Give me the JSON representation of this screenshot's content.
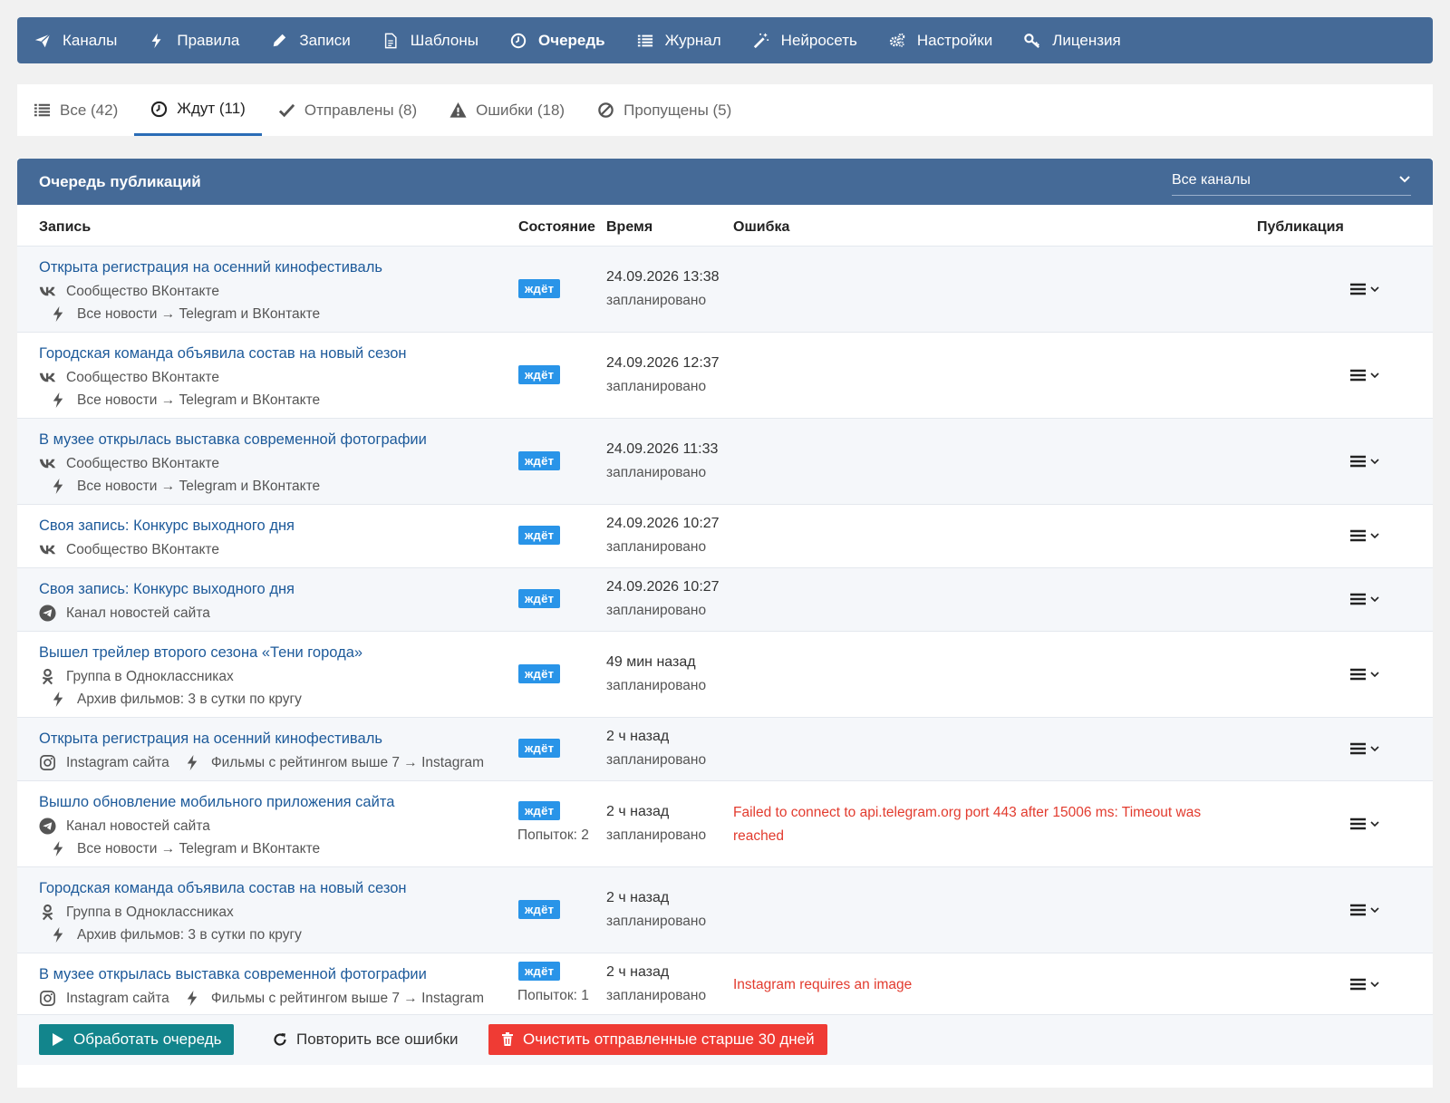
{
  "nav": {
    "items": [
      {
        "label": "Каналы",
        "icon": "paper-plane-icon"
      },
      {
        "label": "Правила",
        "icon": "bolt-icon"
      },
      {
        "label": "Записи",
        "icon": "pencil-icon"
      },
      {
        "label": "Шаблоны",
        "icon": "document-icon"
      },
      {
        "label": "Очередь",
        "icon": "clock-icon"
      },
      {
        "label": "Журнал",
        "icon": "list-icon"
      },
      {
        "label": "Нейросеть",
        "icon": "magic-wand-icon"
      },
      {
        "label": "Настройки",
        "icon": "gears-icon"
      },
      {
        "label": "Лицензия",
        "icon": "key-icon"
      }
    ],
    "active": "Очередь"
  },
  "tabs": [
    {
      "label": "Все (42)",
      "icon": "list-icon"
    },
    {
      "label": "Ждут (11)",
      "icon": "clock-icon"
    },
    {
      "label": "Отправлены (8)",
      "icon": "check-icon"
    },
    {
      "label": "Ошибки (18)",
      "icon": "warning-icon"
    },
    {
      "label": "Пропущены (5)",
      "icon": "ban-icon"
    }
  ],
  "active_tab": "Ждут (11)",
  "panel": {
    "title": "Очередь публикаций",
    "channel_filter": "Все каналы"
  },
  "columns": {
    "record": "Запись",
    "state": "Состояние",
    "time": "Время",
    "error": "Ошибка",
    "publication": "Публикация"
  },
  "rows": [
    {
      "title": "Открыта регистрация на осенний кинофестиваль",
      "channel": "Сообщество ВКонтакте",
      "channel_icon": "vk-icon",
      "rule": "Все новости → Telegram и ВКонтакте",
      "badge": "ждёт",
      "attempts": "",
      "time": "24.09.2026 13:38",
      "status": "запланировано",
      "error": ""
    },
    {
      "title": "Городская команда объявила состав на новый сезон",
      "channel": "Сообщество ВКонтакте",
      "channel_icon": "vk-icon",
      "rule": "Все новости → Telegram и ВКонтакте",
      "badge": "ждёт",
      "attempts": "",
      "time": "24.09.2026 12:37",
      "status": "запланировано",
      "error": ""
    },
    {
      "title": "В музее открылась выставка современной фотографии",
      "channel": "Сообщество ВКонтакте",
      "channel_icon": "vk-icon",
      "rule": "Все новости → Telegram и ВКонтакте",
      "badge": "ждёт",
      "attempts": "",
      "time": "24.09.2026 11:33",
      "status": "запланировано",
      "error": ""
    },
    {
      "title": "Своя запись: Конкурс выходного дня",
      "channel": "Сообщество ВКонтакте",
      "channel_icon": "vk-icon",
      "rule": "",
      "badge": "ждёт",
      "attempts": "",
      "time": "24.09.2026 10:27",
      "status": "запланировано",
      "error": ""
    },
    {
      "title": "Своя запись: Конкурс выходного дня",
      "channel": "Канал новостей сайта",
      "channel_icon": "telegram-icon",
      "rule": "",
      "badge": "ждёт",
      "attempts": "",
      "time": "24.09.2026 10:27",
      "status": "запланировано",
      "error": ""
    },
    {
      "title": "Вышел трейлер второго сезона «Тени города»",
      "channel": "Группа в Одноклассниках",
      "channel_icon": "odnoklassniki-icon",
      "rule": "Архив фильмов: 3 в сутки по кругу",
      "badge": "ждёт",
      "attempts": "",
      "time": "49 мин назад",
      "status": "запланировано",
      "error": ""
    },
    {
      "title": "Открыта регистрация на осенний кинофестиваль",
      "channel": "Instagram сайта",
      "channel_icon": "instagram-icon",
      "rule": "Фильмы с рейтингом выше 7 → Instagram",
      "rule_inline": true,
      "badge": "ждёт",
      "attempts": "",
      "time": "2 ч назад",
      "status": "запланировано",
      "error": ""
    },
    {
      "title": "Вышло обновление мобильного приложения сайта",
      "channel": "Канал новостей сайта",
      "channel_icon": "telegram-icon",
      "rule": "Все новости → Telegram и ВКонтакте",
      "badge": "ждёт",
      "attempts": "Попыток: 2",
      "time": "2 ч назад",
      "status": "запланировано",
      "error": "Failed to connect to api.telegram.org port 443 after 15006 ms: Timeout was reached"
    },
    {
      "title": "Городская команда объявила состав на новый сезон",
      "channel": "Группа в Одноклассниках",
      "channel_icon": "odnoklassniki-icon",
      "rule": "Архив фильмов: 3 в сутки по кругу",
      "badge": "ждёт",
      "attempts": "",
      "time": "2 ч назад",
      "status": "запланировано",
      "error": ""
    },
    {
      "title": "В музее открылась выставка современной фотографии",
      "channel": "Instagram сайта",
      "channel_icon": "instagram-icon",
      "rule": "Фильмы с рейтингом выше 7 → Instagram",
      "rule_inline": true,
      "badge": "ждёт",
      "attempts": "Попыток: 1",
      "time": "2 ч назад",
      "status": "запланировано",
      "error": "Instagram requires an image"
    }
  ],
  "footer": {
    "process": "Обработать очередь",
    "retry": "Повторить все ошибки",
    "clear": "Очистить отправленные старше 30 дней"
  }
}
